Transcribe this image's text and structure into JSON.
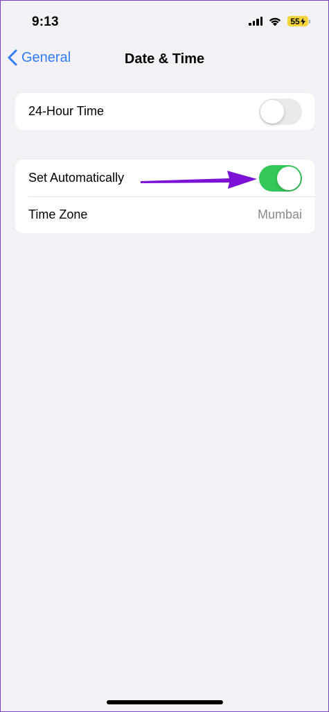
{
  "status_bar": {
    "time": "9:13",
    "battery": "55",
    "battery_color": "#f5d33b"
  },
  "nav": {
    "back_label": "General",
    "title": "Date & Time"
  },
  "settings": {
    "hour24": {
      "label": "24-Hour Time",
      "on": false
    },
    "set_automatically": {
      "label": "Set Automatically",
      "on": true
    },
    "time_zone": {
      "label": "Time Zone",
      "value": "Mumbai"
    }
  },
  "colors": {
    "accent": "#2f7cf6",
    "toggle_on": "#34c759",
    "annotation": "#7b12d6"
  }
}
